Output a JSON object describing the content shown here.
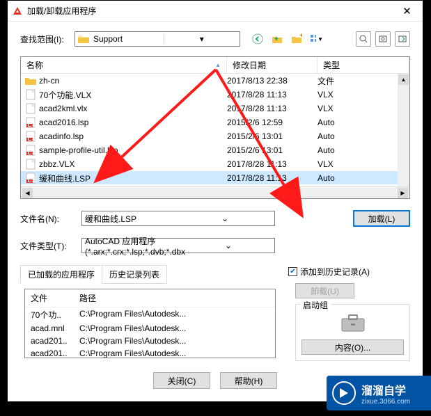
{
  "title": "加载/卸载应用程序",
  "location": {
    "label": "查找范围(I):",
    "value": "Support"
  },
  "columns": {
    "name": "名称",
    "date": "修改日期",
    "type": "类型"
  },
  "files": [
    {
      "icon": "folder",
      "name": "zh-cn",
      "date": "2017/8/13 22:38",
      "type": "文件"
    },
    {
      "icon": "file",
      "name": "70个功能.VLX",
      "date": "2017/8/28 11:13",
      "type": "VLX"
    },
    {
      "icon": "file",
      "name": "acad2kml.vlx",
      "date": "2017/8/28 11:13",
      "type": "VLX"
    },
    {
      "icon": "lsp",
      "name": "acad2016.lsp",
      "date": "2015/2/6 12:59",
      "type": "Auto"
    },
    {
      "icon": "lsp",
      "name": "acadinfo.lsp",
      "date": "2015/2/6 13:01",
      "type": "Auto"
    },
    {
      "icon": "lsp",
      "name": "sample-profile-util.lsp",
      "date": "2015/2/6 13:01",
      "type": "Auto"
    },
    {
      "icon": "file",
      "name": "zbbz.VLX",
      "date": "2017/8/28 11:13",
      "type": "VLX"
    },
    {
      "icon": "lsp",
      "name": "缓和曲线.LSP",
      "date": "2017/8/28 11:13",
      "type": "Auto"
    }
  ],
  "fileName": {
    "label": "文件名(N):",
    "value": "缓和曲线.LSP"
  },
  "fileType": {
    "label": "文件类型(T):",
    "value": "AutoCAD 应用程序(*.arx;*.crx;*.lsp;*.dvb;*.dbx"
  },
  "loadBtn": "加载(L)",
  "tabs": {
    "loaded": "已加载的应用程序",
    "history": "历史记录列表"
  },
  "loadedHead": {
    "file": "文件",
    "path": "路径"
  },
  "loadedRows": [
    {
      "f": "70个功..",
      "p": "C:\\Program Files\\Autodesk..."
    },
    {
      "f": "acad.mnl",
      "p": "C:\\Program Files\\Autodesk..."
    },
    {
      "f": "acad201..",
      "p": "C:\\Program Files\\Autodesk..."
    },
    {
      "f": "acad201..",
      "p": "C:\\Program Files\\Autodesk..."
    }
  ],
  "addHistory": "添加到历史记录(A)",
  "unloadBtn": "卸载(U)",
  "startGroup": "启动组",
  "contentBtn": "内容(O)...",
  "closeBtn": "关闭(C)",
  "helpBtn": "帮助(H)",
  "watermark": {
    "name": "溜溜自学",
    "url": "zixue.3d66.com"
  }
}
